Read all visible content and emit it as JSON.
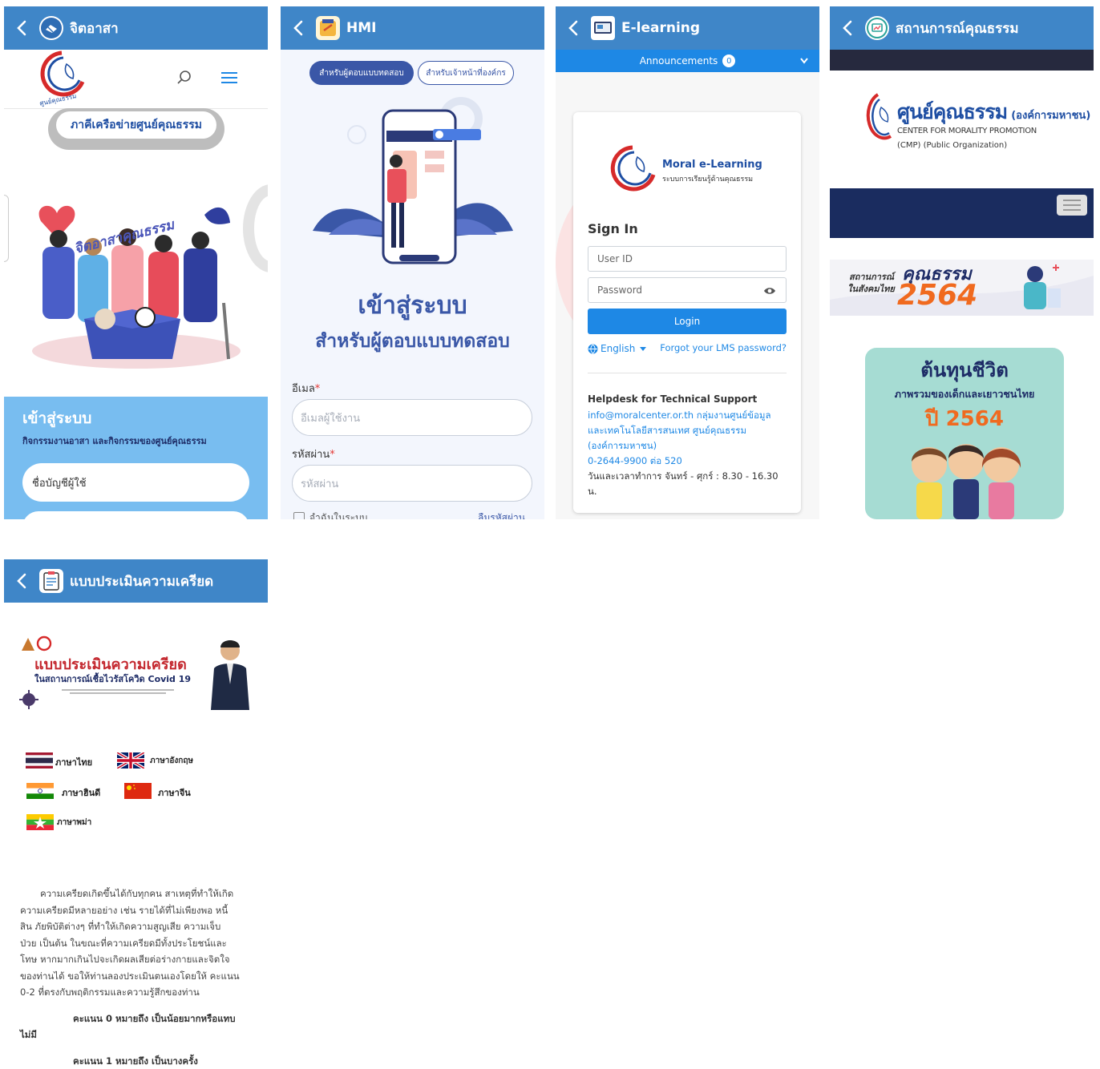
{
  "panel1": {
    "title": "จิตอาสา",
    "logo_text": "ศูนย์คุณธรรม",
    "network_button": "ภาคีเครือข่ายศูนย์คุณธรรม",
    "illustration_text": "จิตอาสาคุณธรรม",
    "login_title": "เข้าสู่ระบบ",
    "login_subtitle": "กิจกรรมงานอาสา และกิจกรรมของศูนย์คุณธรรม",
    "username_placeholder": "ชื่อบัญชีผู้ใช้"
  },
  "panel2": {
    "title": "HMI",
    "tab_active": "สำหรับผู้ตอบแบบทดสอบ",
    "tab_inactive": "สำหรับเจ้าหน้าที่องค์กร",
    "heading": "เข้าสู่ระบบ",
    "subheading": "สำหรับผู้ตอบแบบทดสอบ",
    "email_label": "อีเมล",
    "email_placeholder": "อีเมลผู้ใช้งาน",
    "password_label": "รหัสผ่าน",
    "password_placeholder": "รหัสผ่าน",
    "remember_label": "จำฉันในระบบ",
    "forgot_label": "ลืมรหัสผ่าน",
    "required_mark": "*"
  },
  "panel3": {
    "title": "E-learning",
    "announcements_label": "Announcements",
    "announcements_count": "0",
    "brand_name": "Moral e-Learning",
    "brand_sub": "ระบบการเรียนรู้ด้านคุณธรรม",
    "sign_in": "Sign In",
    "userid_placeholder": "User ID",
    "password_placeholder": "Password",
    "login_button": "Login",
    "language": "English",
    "forgot": "Forgot your LMS password?",
    "helpdesk_title": "Helpdesk for Technical Support",
    "helpdesk_line1": "info@moralcenter.or.th กลุ่มงานศูนย์ข้อมูล",
    "helpdesk_line2": "และเทคโนโลยีสารสนเทศ ศูนย์คุณธรรม",
    "helpdesk_line3": "(องค์การมหาชน)",
    "helpdesk_phone": "0-2644-9900 ต่อ 520",
    "helpdesk_hours": "วันและเวลาทำการ จันทร์ - ศุกร์ : 8.30 - 16.30",
    "helpdesk_hours_cont": "น."
  },
  "panel4": {
    "title": "สถานการณ์คุณธรรม",
    "logo_main": "ศูนย์คุณธรรม",
    "logo_paren": "(องค์การมหาชน)",
    "logo_en1": "CENTER FOR MORALITY PROMOTION",
    "logo_en2": "(CMP) (Public Organization)",
    "banner_small1": "สถานการณ์",
    "banner_small2": "ในสังคมไทย",
    "banner_big": "คุณธรรม",
    "banner_year": "2564",
    "card_title": "ต้นทุนชีวิต",
    "card_sub": "ภาพรวมของเด็กและเยาวชนไทย",
    "card_year": "ปี 2564"
  },
  "panel5": {
    "title": "แบบประเมินความเครียด",
    "banner_title": "แบบประเมินความเครียด",
    "banner_sub": "ในสถานการณ์เชื้อไวรัสโควิด Covid 19",
    "lang_thai": "ภาษาไทย",
    "lang_english": "ภาษาอังกฤษ",
    "lang_hindi": "ภาษาฮินดี",
    "lang_chinese": "ภาษาจีน",
    "lang_burmese": "ภาษาพม่า",
    "para_lines": [
      "ความเครียดเกิดขึ้นได้กับทุกคน สาเหตุที่ทำให้เกิด",
      "ความเครียดมีหลายอย่าง เช่น รายได้ที่ไม่เพียงพอ หนี้",
      "สิน ภัยพิบัติต่างๆ ที่ทำให้เกิดความสูญเสีย ความเจ็บ",
      "ป่วย เป็นต้น ในขณะที่ความเครียดมีทั้งประโยชน์และ",
      "โทษ หากมากเกินไปจะเกิดผลเสียต่อร่างกายและจิตใจ",
      "ของท่านได้ ขอให้ท่านลองประเมินตนเองโดยให้ คะแนน",
      "0-2 ที่ตรงกับพฤติกรรมและความรู้สึกของท่าน"
    ],
    "score0": "คะแนน 0 หมายถึง เป็นน้อยมากหรือแทบ",
    "score0_cont": "ไม่มี",
    "score1": "คะแนน 1 หมายถึง เป็นบางครั้ง"
  },
  "colors": {
    "header": "#3f86c8",
    "primary_blue": "#1e88e5",
    "hmi_blue": "#3a57a7",
    "accent_orange": "#f06a1f"
  }
}
